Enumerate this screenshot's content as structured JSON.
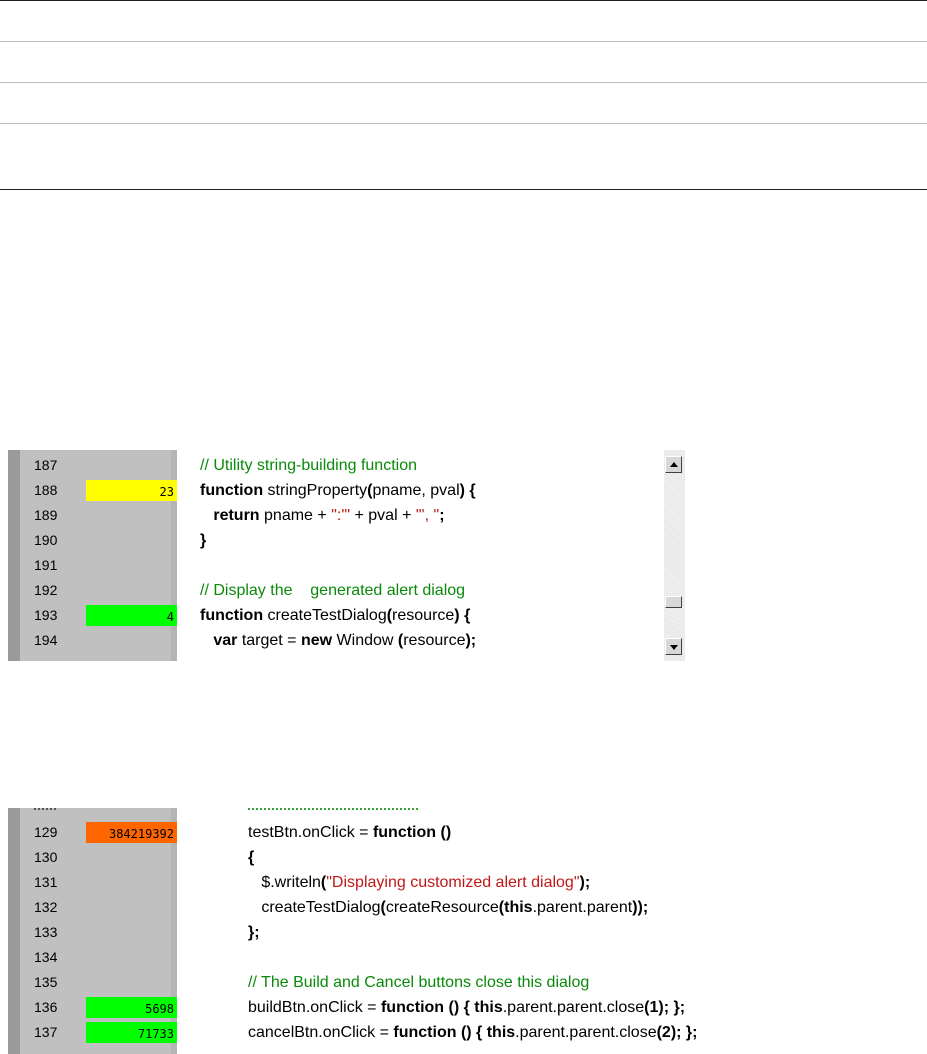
{
  "editor1": {
    "lines": [
      {
        "num": "187",
        "count": "",
        "count_color": "",
        "code": [
          {
            "t": "// Utility string-building function",
            "c": "cm"
          }
        ]
      },
      {
        "num": "188",
        "count": "23",
        "count_color": "#ffff00",
        "code": [
          {
            "t": "function",
            "c": "kw"
          },
          {
            "t": " stringProperty",
            "c": ""
          },
          {
            "t": "(",
            "c": "kw"
          },
          {
            "t": "pname, pval",
            "c": ""
          },
          {
            "t": ") {",
            "c": "kw"
          }
        ]
      },
      {
        "num": "189",
        "count": "",
        "count_color": "",
        "code": [
          {
            "t": "   ",
            "c": ""
          },
          {
            "t": "return",
            "c": "kw"
          },
          {
            "t": " pname + ",
            "c": ""
          },
          {
            "t": "\":'\"",
            "c": "st"
          },
          {
            "t": " + pval + ",
            "c": ""
          },
          {
            "t": "\"', \"",
            "c": "st"
          },
          {
            "t": ";",
            "c": "kw"
          }
        ]
      },
      {
        "num": "190",
        "count": "",
        "count_color": "",
        "code": [
          {
            "t": "}",
            "c": "kw"
          }
        ]
      },
      {
        "num": "191",
        "count": "",
        "count_color": "",
        "code": []
      },
      {
        "num": "192",
        "count": "",
        "count_color": "",
        "code": [
          {
            "t": "// Display the    generated alert dialog",
            "c": "cm"
          }
        ]
      },
      {
        "num": "193",
        "count": "4",
        "count_color": "#00ff00",
        "code": [
          {
            "t": "function",
            "c": "kw"
          },
          {
            "t": " createTestDialog",
            "c": ""
          },
          {
            "t": "(",
            "c": "kw"
          },
          {
            "t": "resource",
            "c": ""
          },
          {
            "t": ") {",
            "c": "kw"
          }
        ]
      },
      {
        "num": "194",
        "count": "",
        "count_color": "",
        "code": [
          {
            "t": "   ",
            "c": ""
          },
          {
            "t": "var",
            "c": "kw"
          },
          {
            "t": " target = ",
            "c": ""
          },
          {
            "t": "new",
            "c": "kw"
          },
          {
            "t": " Window ",
            "c": ""
          },
          {
            "t": "(",
            "c": "kw"
          },
          {
            "t": "resource",
            "c": ""
          },
          {
            "t": ");",
            "c": "kw"
          }
        ]
      }
    ]
  },
  "editor2": {
    "lines": [
      {
        "num": "129",
        "count": "384219392",
        "count_color": "#ff6600",
        "code": [
          {
            "t": "testBtn.onClick = ",
            "c": ""
          },
          {
            "t": "function ()",
            "c": "kw"
          }
        ]
      },
      {
        "num": "130",
        "count": "",
        "count_color": "",
        "code": [
          {
            "t": "{",
            "c": "kw"
          }
        ]
      },
      {
        "num": "131",
        "count": "",
        "count_color": "",
        "code": [
          {
            "t": "   $.writeln",
            "c": ""
          },
          {
            "t": "(",
            "c": "kw"
          },
          {
            "t": "\"Displaying customized alert dialog\"",
            "c": "st"
          },
          {
            "t": ");",
            "c": "kw"
          }
        ]
      },
      {
        "num": "132",
        "count": "",
        "count_color": "",
        "code": [
          {
            "t": "   createTestDialog",
            "c": ""
          },
          {
            "t": "(",
            "c": "kw"
          },
          {
            "t": "createResource",
            "c": ""
          },
          {
            "t": "(",
            "c": "kw"
          },
          {
            "t": "this",
            "c": "kw"
          },
          {
            "t": ".parent.parent",
            "c": ""
          },
          {
            "t": "));",
            "c": "kw"
          }
        ]
      },
      {
        "num": "133",
        "count": "",
        "count_color": "",
        "code": [
          {
            "t": "};",
            "c": "kw"
          }
        ]
      },
      {
        "num": "134",
        "count": "",
        "count_color": "",
        "code": []
      },
      {
        "num": "135",
        "count": "",
        "count_color": "",
        "code": [
          {
            "t": "// The Build and Cancel buttons close this dialog",
            "c": "cm"
          }
        ]
      },
      {
        "num": "136",
        "count": "5698",
        "count_color": "#00ff00",
        "code": [
          {
            "t": "buildBtn.onClick = ",
            "c": ""
          },
          {
            "t": "function () { this",
            "c": "kw"
          },
          {
            "t": ".parent.parent.close",
            "c": ""
          },
          {
            "t": "(1); };",
            "c": "kw"
          }
        ]
      },
      {
        "num": "137",
        "count": "71733",
        "count_color": "#00ff00",
        "code": [
          {
            "t": "cancelBtn.onClick = ",
            "c": ""
          },
          {
            "t": "function () { this",
            "c": "kw"
          },
          {
            "t": ".parent.parent.close",
            "c": ""
          },
          {
            "t": "(2); };",
            "c": "kw"
          }
        ]
      }
    ]
  }
}
